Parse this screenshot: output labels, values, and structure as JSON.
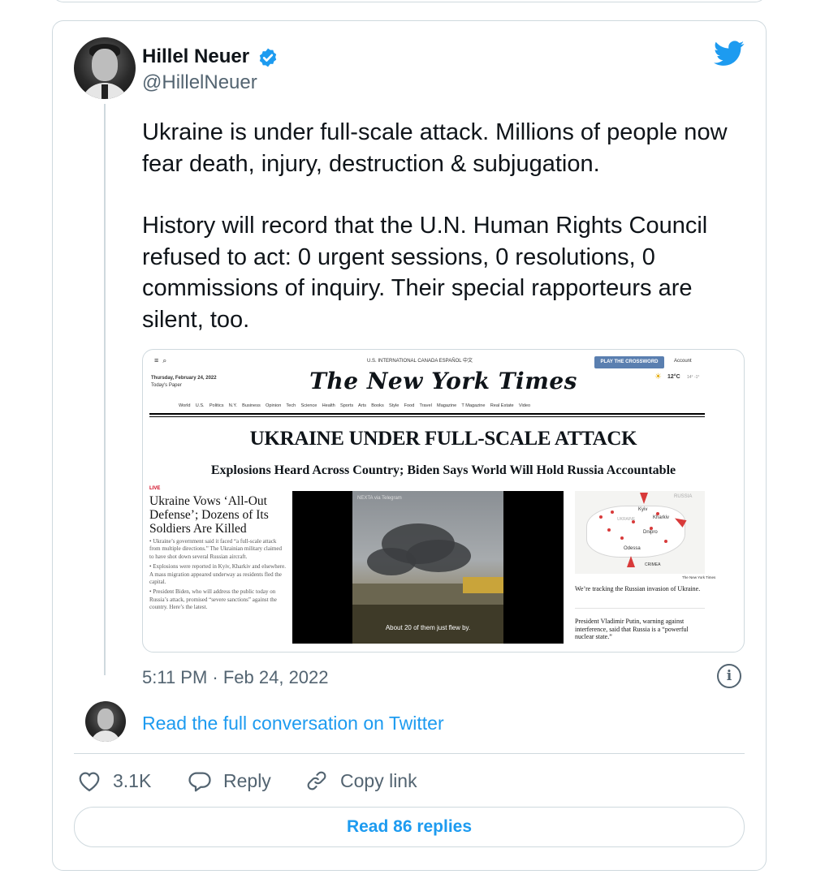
{
  "author": {
    "name": "Hillel Neuer",
    "handle": "@HillelNeuer",
    "verified": true
  },
  "tweet": {
    "paragraphs": [
      "Ukraine is under full-scale attack. Millions of people now fear death, injury, destruction & subjugation.",
      "History will record that the U.N. Human Rights Council refused to act: 0 urgent sessions, 0 resolutions, 0 commissions of inquiry. Their special rapporteurs are silent, too."
    ],
    "timestamp": "5:11 PM · Feb 24, 2022"
  },
  "media": {
    "nav_top": "U.S.   INTERNATIONAL   CANADA   ESPAÑOL   中文",
    "date": "Thursday, February 24, 2022",
    "todays_paper": "Today's Paper",
    "masthead": "The New York Times",
    "crossword": "PLAY THE CROSSWORD",
    "account": "Account",
    "weather": "12°C",
    "weather_range": "14° -1°",
    "sections": "World    U.S.    Politics    N.Y.    Business    Opinion    Tech    Science    Health    Sports    Arts    Books    Style    Food    Travel    Magazine    T Magazine    Real Estate    Video",
    "headline": "UKRAINE UNDER FULL-SCALE ATTACK",
    "subhead": "Explosions Heard Across Country; Biden Says World Will Hold Russia Accountable",
    "live_label": "LIVE",
    "story_headline": "Ukraine Vows ‘All-Out Defense’; Dozens of Its Soldiers Are Killed",
    "bullets": [
      "• Ukraine’s government said it faced “a full-scale attack from multiple directions.” The Ukrainian military claimed to have shot down several Russian aircraft.",
      "• Explosions were reported in Kyiv, Kharkiv and elsewhere. A mass migration appeared underway as residents fled the capital.",
      "• President Biden, who will address the public today on Russia’s attack, promised “severe sanctions” against the country. Here’s the latest."
    ],
    "video_source": "NEXTA via Telegram",
    "video_caption": "About 20 of them just flew by.",
    "map_labels": {
      "russia": "RUSSIA",
      "ukraine": "UKRAINE",
      "kyiv": "Kyiv",
      "kharkiv": "Kharkiv",
      "dnipro": "Dnipro",
      "odessa": "Odessa",
      "crimea": "CRIMEA",
      "credit": "The New York Times"
    },
    "tracking_text": "We’re tracking the Russian invasion of Ukraine.",
    "putin_text": "President Vladimir Putin, warning against interference, said that Russia is a “powerful nuclear state.”"
  },
  "conversation_link": "Read the full conversation on Twitter",
  "actions": {
    "likes": "3.1K",
    "reply": "Reply",
    "copy_link": "Copy link"
  },
  "read_replies": "Read 86 replies",
  "colors": {
    "accent": "#1d9bf0",
    "secondary_text": "#536471",
    "border": "#cfd9de"
  },
  "icons": [
    "verified-badge-icon",
    "twitter-bird-icon",
    "info-icon",
    "heart-icon",
    "reply-icon",
    "link-icon"
  ]
}
